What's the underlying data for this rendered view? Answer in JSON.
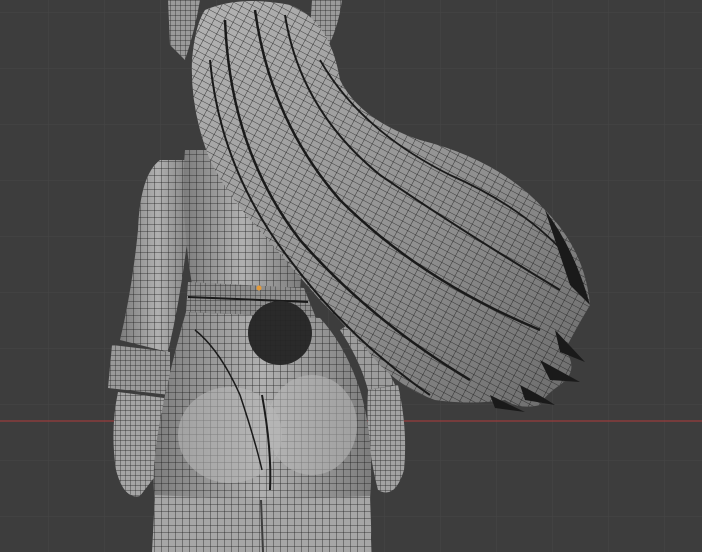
{
  "viewport": {
    "view": "back",
    "shading": "solid-wireframe",
    "colors": {
      "background": "#3d3d3d",
      "grid_line": "#474747",
      "x_axis": "#8a3d3d",
      "mesh_light": "#a8a8a8",
      "mesh_mid": "#8c8c8c",
      "mesh_dark": "#6e6e6e",
      "wire": "#1a1a1a",
      "origin_dot": "#e39a3a"
    }
  }
}
